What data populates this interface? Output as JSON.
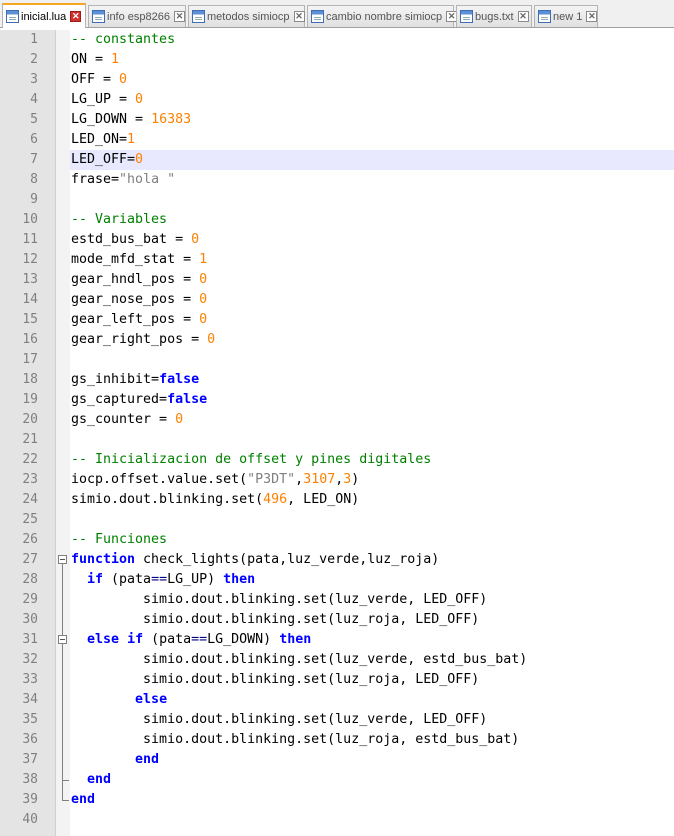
{
  "tabs": [
    {
      "label": "inicial.lua",
      "active": true
    },
    {
      "label": "info esp8266",
      "active": false
    },
    {
      "label": "metodos simiocp",
      "active": false
    },
    {
      "label": "cambio nombre simiocp",
      "active": false
    },
    {
      "label": "bugs.txt",
      "active": false
    },
    {
      "label": "new 1",
      "active": false
    }
  ],
  "icons": {
    "tab_file": "file-icon",
    "tab_close": "close-icon",
    "fold": "fold-minus-icon"
  },
  "colors": {
    "comment": "#008000",
    "number": "#ff8000",
    "keyword": "#0000ff",
    "string": "#808080",
    "current_line": "#e8e8ff",
    "active_tab_accent": "#f5a623"
  },
  "editor": {
    "current_line": 7,
    "lines": [
      {
        "n": "1",
        "tokens": [
          {
            "t": "-- constantes",
            "c": "comment"
          }
        ]
      },
      {
        "n": "2",
        "tokens": [
          {
            "t": "ON = "
          },
          {
            "t": "1",
            "c": "number"
          }
        ]
      },
      {
        "n": "3",
        "tokens": [
          {
            "t": "OFF = "
          },
          {
            "t": "0",
            "c": "number"
          }
        ]
      },
      {
        "n": "4",
        "tokens": [
          {
            "t": "LG_UP = "
          },
          {
            "t": "0",
            "c": "number"
          }
        ]
      },
      {
        "n": "5",
        "tokens": [
          {
            "t": "LG_DOWN = "
          },
          {
            "t": "16383",
            "c": "number"
          }
        ]
      },
      {
        "n": "6",
        "tokens": [
          {
            "t": "LED_ON="
          },
          {
            "t": "1",
            "c": "number"
          }
        ]
      },
      {
        "n": "7",
        "tokens": [
          {
            "t": "LED_OFF="
          },
          {
            "t": "0",
            "c": "number"
          }
        ]
      },
      {
        "n": "8",
        "tokens": [
          {
            "t": "frase="
          },
          {
            "t": "\"hola \"",
            "c": "string"
          }
        ]
      },
      {
        "n": "9",
        "tokens": []
      },
      {
        "n": "10",
        "tokens": [
          {
            "t": "-- Variables",
            "c": "comment"
          }
        ]
      },
      {
        "n": "11",
        "tokens": [
          {
            "t": "estd_bus_bat = "
          },
          {
            "t": "0",
            "c": "number"
          }
        ]
      },
      {
        "n": "12",
        "tokens": [
          {
            "t": "mode_mfd_stat = "
          },
          {
            "t": "1",
            "c": "number"
          }
        ]
      },
      {
        "n": "13",
        "tokens": [
          {
            "t": "gear_hndl_pos = "
          },
          {
            "t": "0",
            "c": "number"
          }
        ]
      },
      {
        "n": "14",
        "tokens": [
          {
            "t": "gear_nose_pos = "
          },
          {
            "t": "0",
            "c": "number"
          }
        ]
      },
      {
        "n": "15",
        "tokens": [
          {
            "t": "gear_left_pos = "
          },
          {
            "t": "0",
            "c": "number"
          }
        ]
      },
      {
        "n": "16",
        "tokens": [
          {
            "t": "gear_right_pos = "
          },
          {
            "t": "0",
            "c": "number"
          }
        ]
      },
      {
        "n": "17",
        "tokens": []
      },
      {
        "n": "18",
        "tokens": [
          {
            "t": "gs_inhibit="
          },
          {
            "t": "false",
            "c": "keyword"
          }
        ]
      },
      {
        "n": "19",
        "tokens": [
          {
            "t": "gs_captured="
          },
          {
            "t": "false",
            "c": "keyword"
          }
        ]
      },
      {
        "n": "20",
        "tokens": [
          {
            "t": "gs_counter = "
          },
          {
            "t": "0",
            "c": "number"
          }
        ]
      },
      {
        "n": "21",
        "tokens": []
      },
      {
        "n": "22",
        "tokens": [
          {
            "t": "-- Inicializacion de offset y pines digitales",
            "c": "comment"
          }
        ]
      },
      {
        "n": "23",
        "tokens": [
          {
            "t": "iocp.offset.value.set("
          },
          {
            "t": "\"P3DT\"",
            "c": "string"
          },
          {
            "t": ","
          },
          {
            "t": "3107",
            "c": "number"
          },
          {
            "t": ","
          },
          {
            "t": "3",
            "c": "number"
          },
          {
            "t": ")"
          }
        ]
      },
      {
        "n": "24",
        "tokens": [
          {
            "t": "simio.dout.blinking.set("
          },
          {
            "t": "496",
            "c": "number"
          },
          {
            "t": ", LED_ON)"
          }
        ]
      },
      {
        "n": "25",
        "tokens": []
      },
      {
        "n": "26",
        "tokens": [
          {
            "t": "-- Funciones",
            "c": "comment"
          }
        ]
      },
      {
        "n": "27",
        "tokens": [
          {
            "t": "function",
            "c": "keyword"
          },
          {
            "t": " check_lights(pata,luz_verde,luz_roja)"
          }
        ]
      },
      {
        "n": "28",
        "tokens": [
          {
            "t": "  "
          },
          {
            "t": "if",
            "c": "keyword"
          },
          {
            "t": " (pata"
          },
          {
            "t": "==",
            "c": "op"
          },
          {
            "t": "LG_UP) "
          },
          {
            "t": "then",
            "c": "keyword"
          }
        ]
      },
      {
        "n": "29",
        "tokens": [
          {
            "t": "         simio.dout.blinking.set(luz_verde, LED_OFF)"
          }
        ]
      },
      {
        "n": "30",
        "tokens": [
          {
            "t": "         simio.dout.blinking.set(luz_roja, LED_OFF)"
          }
        ]
      },
      {
        "n": "31",
        "tokens": [
          {
            "t": "  "
          },
          {
            "t": "else",
            "c": "keyword"
          },
          {
            "t": " "
          },
          {
            "t": "if",
            "c": "keyword"
          },
          {
            "t": " (pata"
          },
          {
            "t": "==",
            "c": "op"
          },
          {
            "t": "LG_DOWN) "
          },
          {
            "t": "then",
            "c": "keyword"
          }
        ]
      },
      {
        "n": "32",
        "tokens": [
          {
            "t": "         simio.dout.blinking.set(luz_verde, estd_bus_bat)"
          }
        ]
      },
      {
        "n": "33",
        "tokens": [
          {
            "t": "         simio.dout.blinking.set(luz_roja, LED_OFF)"
          }
        ]
      },
      {
        "n": "34",
        "tokens": [
          {
            "t": "        "
          },
          {
            "t": "else",
            "c": "keyword"
          }
        ]
      },
      {
        "n": "35",
        "tokens": [
          {
            "t": "         simio.dout.blinking.set(luz_verde, LED_OFF)"
          }
        ]
      },
      {
        "n": "36",
        "tokens": [
          {
            "t": "         simio.dout.blinking.set(luz_roja, estd_bus_bat)"
          }
        ]
      },
      {
        "n": "37",
        "tokens": [
          {
            "t": "        "
          },
          {
            "t": "end",
            "c": "keyword"
          }
        ]
      },
      {
        "n": "38",
        "tokens": [
          {
            "t": "  "
          },
          {
            "t": "end",
            "c": "keyword"
          }
        ]
      },
      {
        "n": "39",
        "tokens": [
          {
            "t": "end",
            "c": "keyword"
          }
        ]
      },
      {
        "n": "40",
        "tokens": []
      }
    ]
  }
}
